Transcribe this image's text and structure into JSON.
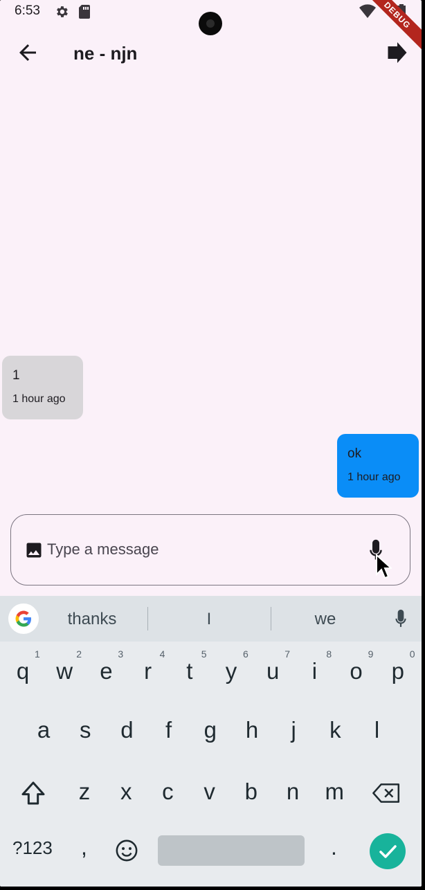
{
  "status_bar": {
    "time": "6:53",
    "debug_label": "DEBUG"
  },
  "app_bar": {
    "title": "ne - njn"
  },
  "messages": [
    {
      "text": "1",
      "time": "1 hour ago",
      "direction": "incoming",
      "color": "#d8d6d9"
    },
    {
      "text": "ok",
      "time": "1 hour ago",
      "direction": "outgoing",
      "color": "#0a8df7"
    }
  ],
  "composer": {
    "placeholder": "Type a message"
  },
  "keyboard": {
    "suggestions": [
      "thanks",
      "I",
      "we"
    ],
    "row1": [
      "q",
      "w",
      "e",
      "r",
      "t",
      "y",
      "u",
      "i",
      "o",
      "p"
    ],
    "row1_hints": [
      "1",
      "2",
      "3",
      "4",
      "5",
      "6",
      "7",
      "8",
      "9",
      "0"
    ],
    "row2": [
      "a",
      "s",
      "d",
      "f",
      "g",
      "h",
      "j",
      "k",
      "l"
    ],
    "row3": [
      "z",
      "x",
      "c",
      "v",
      "b",
      "n",
      "m"
    ],
    "symbols_label": "?123",
    "comma_label": ",",
    "period_label": ".",
    "enter_color": "#18b39b"
  }
}
